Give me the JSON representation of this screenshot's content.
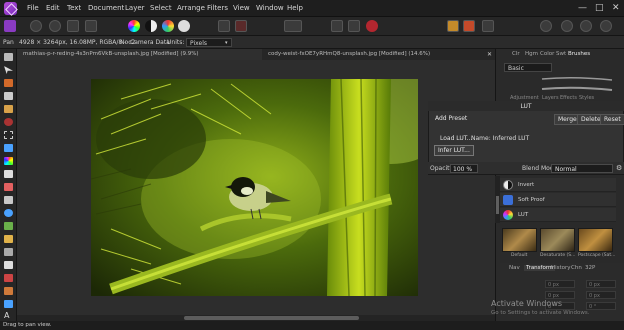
{
  "menubar": {
    "items": [
      "File",
      "Edit",
      "Text",
      "Document",
      "Layer",
      "Select",
      "Arrange",
      "Filters",
      "View",
      "Window",
      "Help"
    ]
  },
  "context_bar": {
    "tool": "Pan",
    "image_info": "4928 × 3264px, 16.08MP, RGBA/8 - c2",
    "camera": "No Camera Data",
    "units_label": "Units:",
    "units_value": "Pixels"
  },
  "document_tabs": [
    {
      "label": "mathias-p-r-reding-4s3nPm6VkB-unsplash.jpg [Modified] (9.9%)"
    },
    {
      "label": "cody-weist-fxOE7yRHmQ8-unsplash.jpg [Modified] (14.6%)"
    }
  ],
  "right_panel": {
    "tabs": [
      "Clr",
      "Hgm",
      "Color",
      "Swt",
      "Brushes"
    ],
    "brush_category": "Basic",
    "sub_tabs": [
      "Adjustment",
      "Layers",
      "Effects",
      "Styles"
    ]
  },
  "lut_dialog": {
    "title": "LUT",
    "add_preset": "Add Preset",
    "merge": "Merge",
    "delete": "Delete",
    "reset": "Reset",
    "load_lut": "Load LUT...",
    "name_label": "Name: Inferred LUT",
    "infer_lut": "Infer LUT...",
    "opacity_label": "Opacity:",
    "opacity_value": "100 %",
    "blend_label": "Blend Mode:",
    "blend_value": "Normal"
  },
  "layers": [
    {
      "label": "Invert",
      "icon": "invert-icon"
    },
    {
      "label": "Soft Proof",
      "icon": "soft-proof-icon"
    },
    {
      "label": "LUT",
      "icon": "lut-icon"
    }
  ],
  "presets": [
    {
      "label": "Default"
    },
    {
      "label": "Desaturate (S..."
    },
    {
      "label": "Postscape (Sat..."
    }
  ],
  "transform_panel": {
    "tabs": [
      "Nav",
      "Transform",
      "History",
      "Chn",
      "32P"
    ],
    "fields": [
      "0 px",
      "0 px",
      "0 px",
      "0 px",
      "0 °",
      "0 °"
    ]
  },
  "status": {
    "hint": "Drag to pan view."
  },
  "activation": {
    "title": "Activate Windows",
    "subtitle": "Go to Settings to activate Windows."
  },
  "colors": {
    "accent": "#c7e100",
    "app_purple": "#9b3fd0",
    "panel_bg": "#2a2a2a"
  }
}
